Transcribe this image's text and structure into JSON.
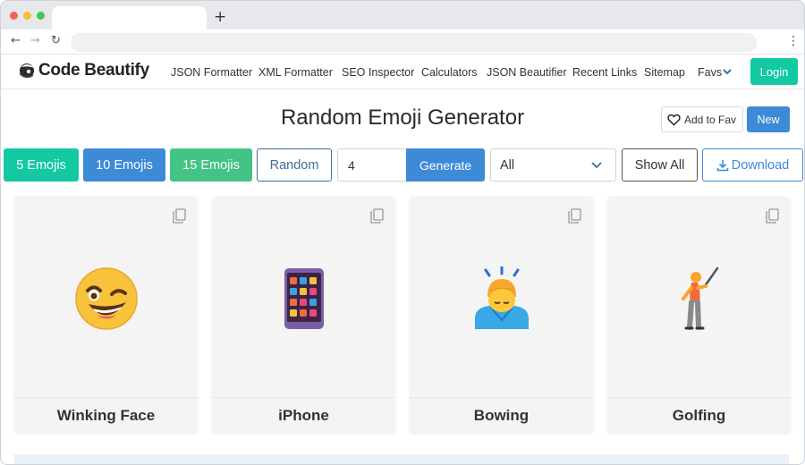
{
  "browser": {
    "new_tab_glyph": "+",
    "back_glyph": "←",
    "forward_glyph": "→",
    "reload_glyph": "↻",
    "menu_glyph": "⋮"
  },
  "site": {
    "logo_text": "Code Beautify",
    "nav": [
      "JSON Formatter",
      "XML Formatter",
      "SEO Inspector",
      "Calculators",
      "JSON Beautifier",
      "Recent Links",
      "Sitemap",
      "Favs"
    ],
    "login_label": "Login"
  },
  "page": {
    "title": "Random Emoji Generator",
    "add_to_fav_label": "Add to Fav",
    "new_label": "New"
  },
  "controls": {
    "five_label": "5 Emojis",
    "ten_label": "10 Emojis",
    "fifteen_label": "15 Emojis",
    "random_label": "Random",
    "count_value": "4",
    "generate_label": "Generate",
    "category_selected": "All",
    "show_all_label": "Show All",
    "download_label": "Download"
  },
  "cards": [
    {
      "name": "Winking Face",
      "icon": "winking-face-emoji"
    },
    {
      "name": "iPhone",
      "icon": "mobile-phone-emoji"
    },
    {
      "name": "Bowing",
      "icon": "person-bowing-emoji"
    },
    {
      "name": "Golfing",
      "icon": "person-golfing-emoji"
    }
  ],
  "colors": {
    "teal": "#12c9a2",
    "blue": "#3d8ad6",
    "green": "#43c484",
    "card_bg": "#f4f4f4"
  }
}
